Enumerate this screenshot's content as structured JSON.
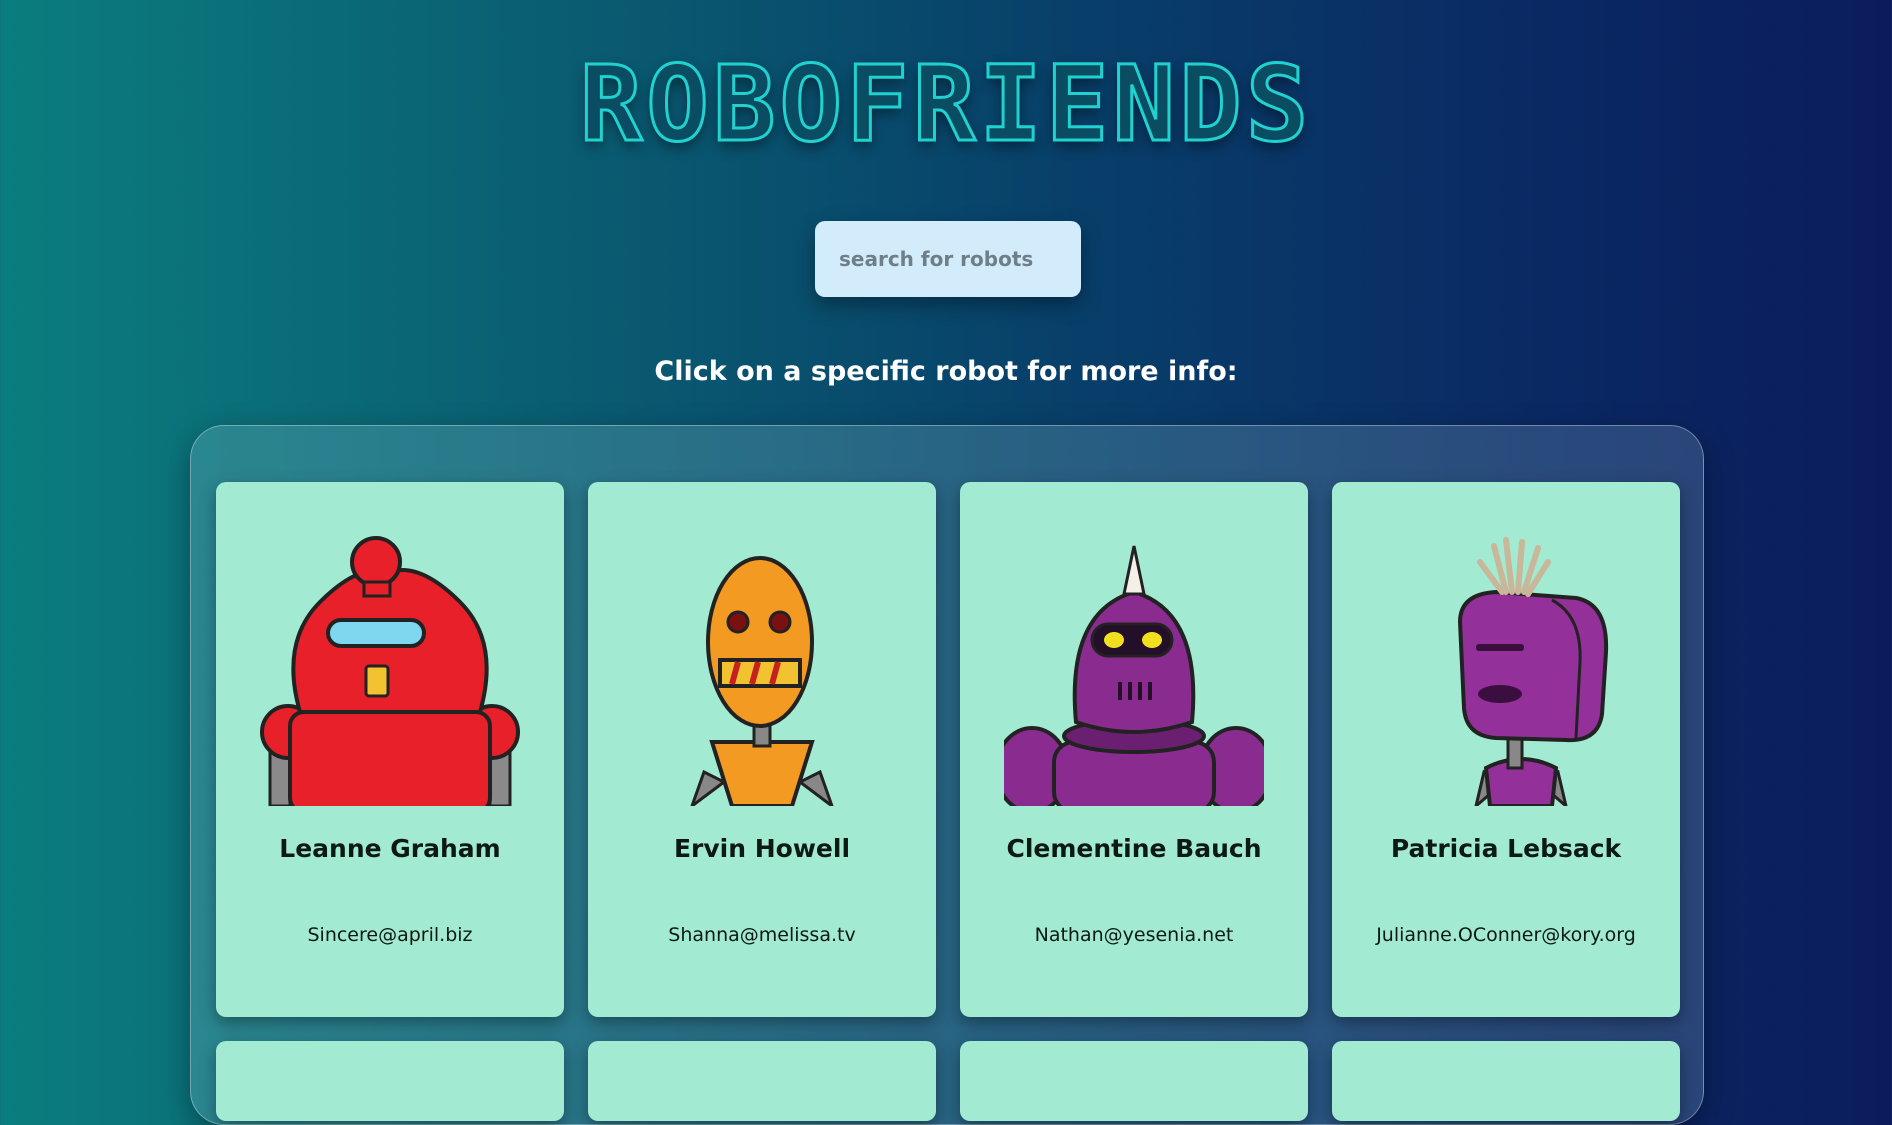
{
  "header": {
    "title": "ROBOFRIENDS"
  },
  "search": {
    "placeholder": "search for robots"
  },
  "hint": "Click on a specific robot for more info:",
  "robots": [
    {
      "name": "Leanne Graham",
      "email": "Sincere@april.biz",
      "color": "#e8202a",
      "icon": "red-robot-icon"
    },
    {
      "name": "Ervin Howell",
      "email": "Shanna@melissa.tv",
      "color": "#f29a22",
      "icon": "orange-robot-icon"
    },
    {
      "name": "Clementine Bauch",
      "email": "Nathan@yesenia.net",
      "color": "#8a2c8f",
      "icon": "purple-spiked-robot-icon"
    },
    {
      "name": "Patricia Lebsack",
      "email": "Julianne.OConner@kory.org",
      "color": "#93309a",
      "icon": "purple-tufted-robot-icon"
    }
  ],
  "colors": {
    "card": "#a2ead2",
    "title": "#1fd2cf",
    "search_bg": "#d2ecfb"
  }
}
